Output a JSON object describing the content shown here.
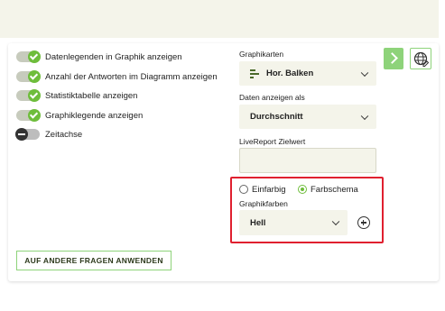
{
  "toggles": [
    {
      "label": "Datenlegenden in Graphik anzeigen",
      "on": true
    },
    {
      "label": "Anzahl der Antworten im Diagramm anzeigen",
      "on": true
    },
    {
      "label": "Statistiktabelle anzeigen",
      "on": true
    },
    {
      "label": "Graphiklegende anzeigen",
      "on": true
    },
    {
      "label": "Zeitachse",
      "on": false
    }
  ],
  "chart_type": {
    "label": "Graphikarten",
    "value": "Hor. Balken",
    "icon": "horizontal-bars-icon"
  },
  "data_display": {
    "label": "Daten anzeigen als",
    "value": "Durchschnitt"
  },
  "livereport": {
    "label": "LiveReport Zielwert",
    "value": ""
  },
  "color_mode": {
    "options": [
      "Einfarbig",
      "Farbschema"
    ],
    "selected": "Farbschema"
  },
  "graph_colors": {
    "label": "Graphikfarben",
    "value": "Hell"
  },
  "apply_button": "AUF ANDERE FRAGEN ANWENDEN",
  "colors": {
    "accent": "#6ebd3b",
    "field_bg": "#f4f4ea",
    "highlight": "#e0202f"
  }
}
